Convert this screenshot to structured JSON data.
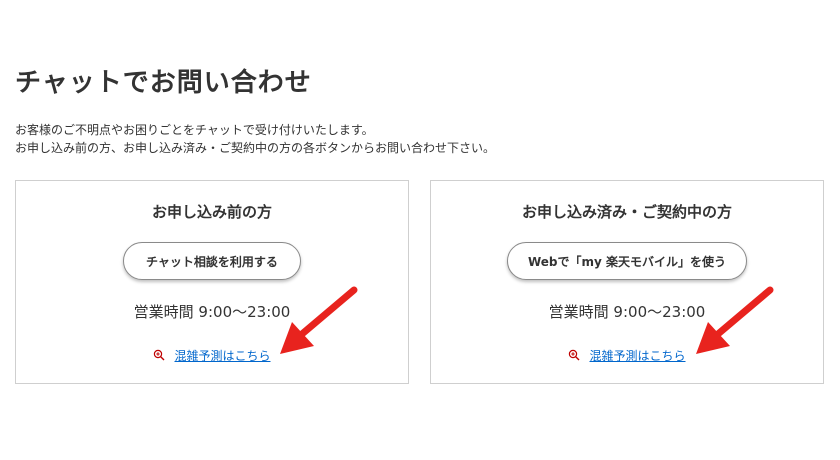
{
  "page": {
    "title": "チャットでお問い合わせ",
    "intro_lines": [
      "お客様のご不明点やお困りごとをチャットで受け付けいたします。",
      "お申し込み前の方、お申し込み済み・ご契約中の方の各ボタンからお問い合わせ下さい。"
    ]
  },
  "cards": [
    {
      "title": "お申し込み前の方",
      "button_label": "チャット相談を利用する",
      "hours": "営業時間 9:00〜23:00",
      "link_label": "混雑予測はこちら"
    },
    {
      "title": "お申し込み済み・ご契約中の方",
      "button_label": "Webで「my 楽天モバイル」を使う",
      "hours": "営業時間 9:00〜23:00",
      "link_label": "混雑予測はこちら"
    }
  ],
  "icons": {
    "link_icon": "zoom-in-icon",
    "annotation": "red-arrow-icon"
  },
  "colors": {
    "link": "#0066cc",
    "icon": "#bf0000",
    "arrow": "#e8231e",
    "border": "#cfcfcf"
  }
}
